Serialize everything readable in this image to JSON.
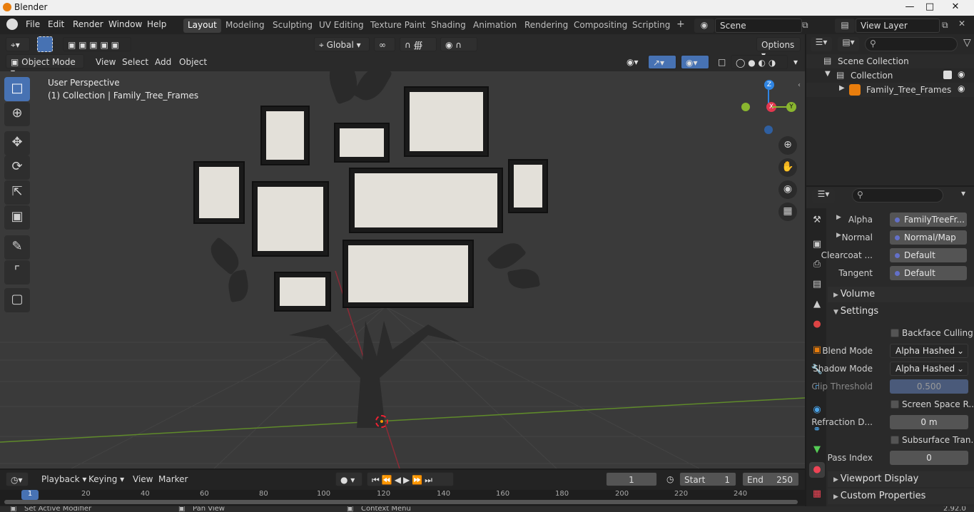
{
  "window": {
    "title": "Blender"
  },
  "menu": {
    "items": [
      "File",
      "Edit",
      "Render",
      "Window",
      "Help"
    ]
  },
  "workspaces": {
    "tabs": [
      "Layout",
      "Modeling",
      "Sculpting",
      "UV Editing",
      "Texture Paint",
      "Shading",
      "Animation",
      "Rendering",
      "Compositing",
      "Scripting"
    ],
    "active": "Layout",
    "add_label": "+"
  },
  "scene": {
    "name": "Scene"
  },
  "view_layer": {
    "name": "View Layer"
  },
  "header": {
    "mode": "Object Mode",
    "menus": [
      "View",
      "Select",
      "Add",
      "Object"
    ],
    "transform_orientation": "Global",
    "options_label": "Options"
  },
  "viewport": {
    "perspective": "User Perspective",
    "collection_info": "(1) Collection | Family_Tree_Frames",
    "axes": {
      "x": "X",
      "y": "Y",
      "z": "Z"
    },
    "colors": {
      "x": "#e3374f",
      "y": "#8ab62f",
      "z": "#2f85e3",
      "grid_x": "#8b2b36",
      "grid_y": "#5f8a2a"
    }
  },
  "outliner": {
    "root": "Scene Collection",
    "collection": "Collection",
    "object": "Family_Tree_Frames"
  },
  "properties": {
    "inputs": [
      {
        "label": "Alpha",
        "value": "FamilyTreeFr..."
      },
      {
        "label": "Normal",
        "value": "Normal/Map"
      },
      {
        "label": "Clearcoat ...",
        "value": "Default"
      },
      {
        "label": "Tangent",
        "value": "Default"
      }
    ],
    "sections": {
      "volume": "Volume",
      "settings": "Settings",
      "viewport_display": "Viewport Display",
      "custom_properties": "Custom Properties"
    },
    "settings": {
      "backface_culling": "Backface Culling",
      "blend_mode_label": "Blend Mode",
      "blend_mode": "Alpha Hashed",
      "shadow_mode_label": "Shadow Mode",
      "shadow_mode": "Alpha Hashed",
      "clip_threshold_label": "Clip Threshold",
      "clip_threshold": "0.500",
      "screen_space": "Screen Space R...",
      "refraction_label": "Refraction D...",
      "refraction": "0 m",
      "subsurface": "Subsurface Tran...",
      "pass_index_label": "Pass Index",
      "pass_index": "0"
    }
  },
  "timeline": {
    "menus": [
      "Playback",
      "Keying",
      "View",
      "Marker"
    ],
    "current_frame": "1",
    "start_label": "Start",
    "start": "1",
    "end_label": "End",
    "end": "250",
    "ruler": [
      "1",
      "20",
      "40",
      "60",
      "80",
      "100",
      "120",
      "140",
      "160",
      "180",
      "200",
      "220",
      "240"
    ]
  },
  "status": {
    "left": "Set Active Modifier",
    "middle": "Pan View",
    "right": "Context Menu",
    "version": "2.92.0"
  }
}
